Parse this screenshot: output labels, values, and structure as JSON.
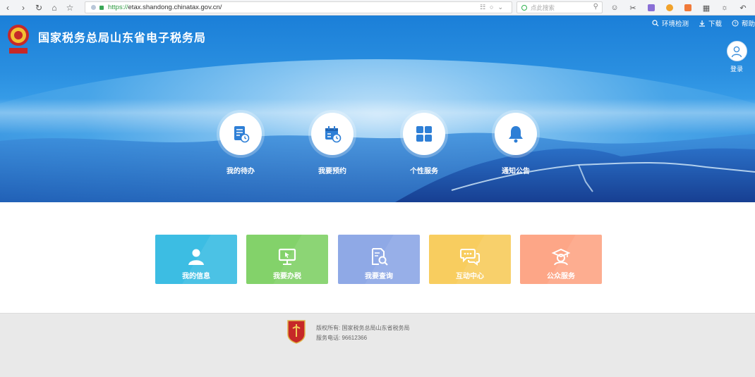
{
  "browser": {
    "url_scheme": "https://",
    "url_rest": "etax.shandong.chinatax.gov.cn/",
    "search_placeholder": "点此搜索"
  },
  "header": {
    "title": "国家税务总局山东省电子税务局",
    "links": [
      {
        "label": "环境检测",
        "icon": "search-icon"
      },
      {
        "label": "下载",
        "icon": "download-icon"
      },
      {
        "label": "帮助",
        "icon": "help-icon"
      }
    ],
    "login_label": "登录"
  },
  "quick_entries": [
    {
      "label": "我的待办",
      "icon": "todo-doc-icon"
    },
    {
      "label": "我要预约",
      "icon": "calendar-icon"
    },
    {
      "label": "个性服务",
      "icon": "grid-icon"
    },
    {
      "label": "通知公告",
      "icon": "bell-icon"
    }
  ],
  "tiles": [
    {
      "label": "我的信息",
      "icon": "user-icon",
      "color": "#3cbde3"
    },
    {
      "label": "我要办税",
      "icon": "monitor-icon",
      "color": "#83d26a"
    },
    {
      "label": "我要查询",
      "icon": "search-doc-icon",
      "color": "#8fa9e6"
    },
    {
      "label": "互动中心",
      "icon": "chat-icon",
      "color": "#f8cd5f"
    },
    {
      "label": "公众服务",
      "icon": "public-service-icon",
      "color": "#fda687"
    }
  ],
  "footer": {
    "copyright": "版权所有: 国家税务总局山东省税务局",
    "phone": "服务电话: 96612366"
  },
  "colors": {
    "banner_blue": "#2a8fe0",
    "footer_bg": "#e9e9e9"
  }
}
